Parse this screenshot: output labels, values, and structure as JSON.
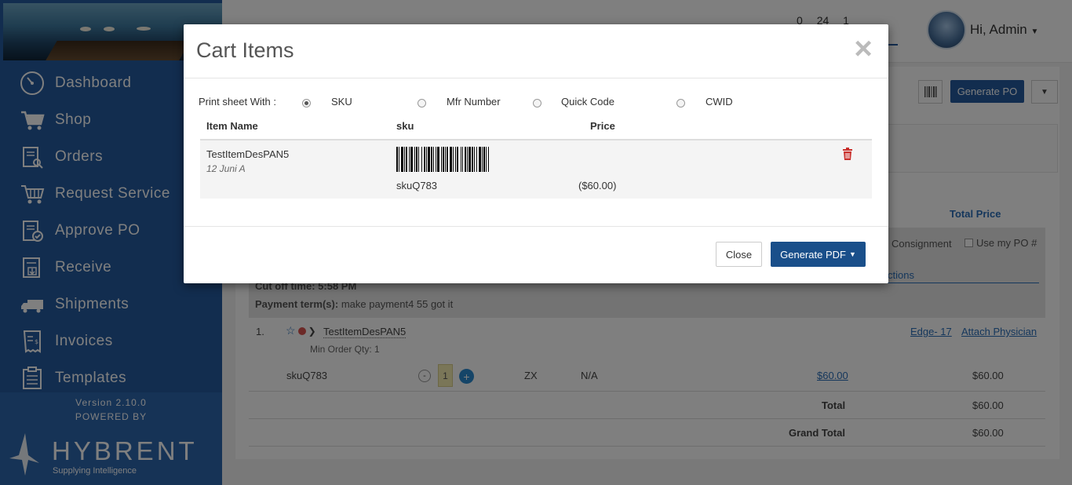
{
  "sidebar": {
    "items": [
      {
        "label": "Dashboard",
        "icon": "dashboard-icon"
      },
      {
        "label": "Shop",
        "icon": "cart-icon"
      },
      {
        "label": "Orders",
        "icon": "orders-icon"
      },
      {
        "label": "Request Service",
        "icon": "request-service-icon"
      },
      {
        "label": "Approve PO",
        "icon": "approve-po-icon"
      },
      {
        "label": "Receive",
        "icon": "receive-icon"
      },
      {
        "label": "Shipments",
        "icon": "truck-icon"
      },
      {
        "label": "Invoices",
        "icon": "invoice-icon"
      },
      {
        "label": "Templates",
        "icon": "templates-icon"
      }
    ],
    "version": "Version 2.10.0",
    "powered_by": "POWERED BY",
    "brand": "HYBRENT",
    "tagline": "Supplying Intelligence"
  },
  "header": {
    "counters": [
      "0",
      "24",
      "1"
    ],
    "user_greeting": "Hi, Admin"
  },
  "page": {
    "generate_po": "Generate PO",
    "total_price_header": "Total Price",
    "consignment": "Consignment",
    "use_my_po": "Use my PO #",
    "instructions": "ctions",
    "cutoff_time": "Cut off time: 5:58 PM",
    "payment_label": "Payment term(s):",
    "payment_value": "make payment4 55 got it",
    "row": {
      "number": "1.",
      "item_name": "TestItemDesPAN5",
      "min_order": "Min Order Qty: 1",
      "edge": "Edge- 17",
      "attach": "Attach Physician",
      "sku": "skuQ783",
      "qty": "1",
      "uom": "ZX",
      "na": "N/A",
      "price": "$60.00",
      "total": "$60.00"
    },
    "total_label": "Total",
    "total_value": "$60.00",
    "grand_total_label": "Grand Total",
    "grand_total_value": "$60.00"
  },
  "modal": {
    "title": "Cart Items",
    "print_label": "Print sheet With :",
    "options": [
      {
        "label": "SKU",
        "checked": true
      },
      {
        "label": "Mfr Number",
        "checked": false
      },
      {
        "label": "Quick Code",
        "checked": false
      },
      {
        "label": "CWID",
        "checked": false
      }
    ],
    "columns": {
      "name": "Item Name",
      "sku": "sku",
      "price": "Price"
    },
    "rows": [
      {
        "name": "TestItemDesPAN5",
        "sub": "12 Juni A",
        "sku": "skuQ783",
        "price": "($60.00)"
      }
    ],
    "close_button": "Close",
    "pdf_button": "Generate PDF"
  },
  "colors": {
    "sidebar": "#245a9e",
    "primary_button": "#1a4f8a",
    "link": "#2a6eb8",
    "danger": "#c9302c"
  }
}
